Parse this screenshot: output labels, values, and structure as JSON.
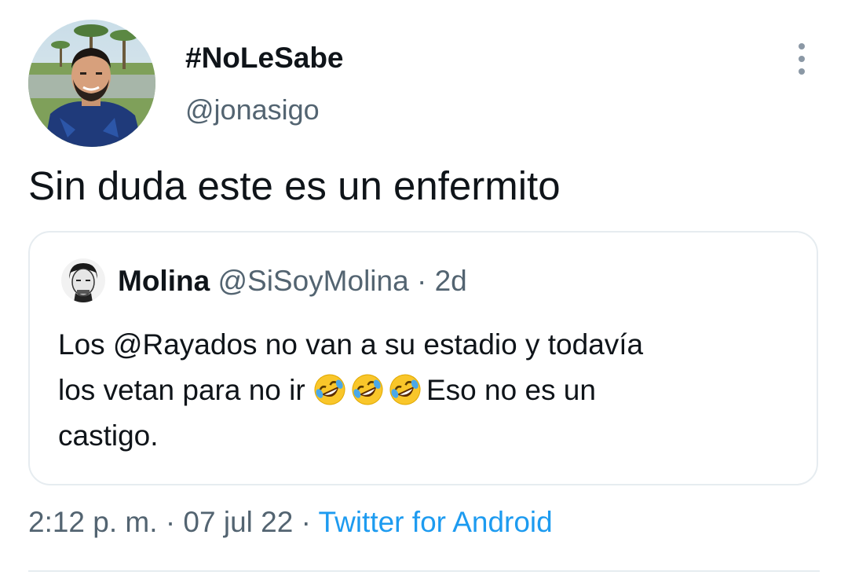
{
  "tweet": {
    "display_name": "#NoLeSabe",
    "handle": "@jonasigo",
    "text": "Sin duda este es un enfermito",
    "more_icon": "more-vertical-icon"
  },
  "quoted_tweet": {
    "name": "Molina",
    "handle": "@SiSoyMolina",
    "separator": "·",
    "time": "2d",
    "text_line1": "Los @Rayados no van a su estadio y todavía",
    "text_line2_prefix": "los vetan para no ir",
    "emojis": [
      "rolling-on-floor-laughing-emoji",
      "rolling-on-floor-laughing-emoji",
      "rolling-on-floor-laughing-emoji"
    ],
    "text_line2_suffix": "Eso no es un",
    "text_line3": "castigo."
  },
  "footer": {
    "time": "2:12 p. m.",
    "separator1": "·",
    "date": "07 jul 22",
    "separator2": "·",
    "source": "Twitter for Android"
  },
  "colors": {
    "primary_text": "#0f1419",
    "secondary_text": "#536471",
    "link": "#1d9bf0",
    "border": "#e6ecf0"
  }
}
